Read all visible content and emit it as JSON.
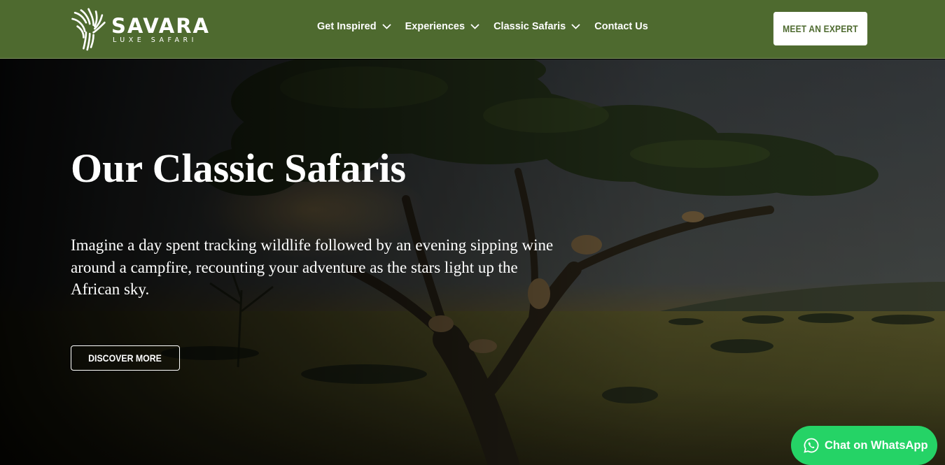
{
  "brand": {
    "name": "SAVARA",
    "tagline": "LUXE SAFARI"
  },
  "nav": {
    "items": [
      {
        "label": "Get Inspired",
        "dropdown": true
      },
      {
        "label": "Experiences",
        "dropdown": true
      },
      {
        "label": "Classic Safaris",
        "dropdown": true
      },
      {
        "label": "Contact Us",
        "dropdown": false
      }
    ],
    "cta_label": "MEET AN EXPERT"
  },
  "hero": {
    "title": "Our Classic Safaris",
    "text": "Imagine a day spent tracking wildlife followed by an evening sipping wine around a campfire, recounting your adventure as the stars light up the African sky.",
    "button_label": "DISCOVER MORE"
  },
  "chat": {
    "label": "Chat on WhatsApp"
  },
  "colors": {
    "header_bg": "#4e6a2f",
    "whatsapp": "#25d366",
    "cta_text": "#4e6a2f"
  },
  "icons": [
    "logo-mark-icon",
    "chevron-down-icon",
    "whatsapp-icon"
  ]
}
